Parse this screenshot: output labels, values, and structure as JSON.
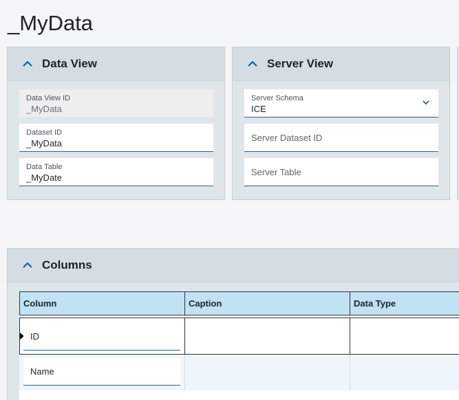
{
  "page": {
    "title": "_MyData"
  },
  "data_view": {
    "title": "Data View",
    "fields": {
      "data_view_id": {
        "label": "Data View ID",
        "value": "_MyData"
      },
      "dataset_id": {
        "label": "Dataset ID",
        "value": "_MyData"
      },
      "data_table": {
        "label": "Data Table",
        "value": "_MyDate"
      }
    }
  },
  "server_view": {
    "title": "Server View",
    "fields": {
      "server_schema": {
        "label": "Server Schema",
        "value": "ICE"
      },
      "server_dataset_id": {
        "placeholder": "Server Dataset ID"
      },
      "server_table": {
        "placeholder": "Server Table"
      }
    }
  },
  "columns_section": {
    "title": "Columns",
    "headers": [
      "Column",
      "Caption",
      "Data Type"
    ],
    "rows": [
      {
        "column": "ID",
        "caption": "",
        "data_type": ""
      },
      {
        "column": "Name",
        "caption": "",
        "data_type": ""
      }
    ]
  },
  "icons": {
    "collapse": "chevron-up-icon",
    "dropdown": "chevron-down-icon",
    "row_indicator": "row-pointer-icon"
  },
  "colors": {
    "accent": "#1f5f8b",
    "panel_header": "#d3dde3",
    "grid_header": "#c0e2f5"
  }
}
